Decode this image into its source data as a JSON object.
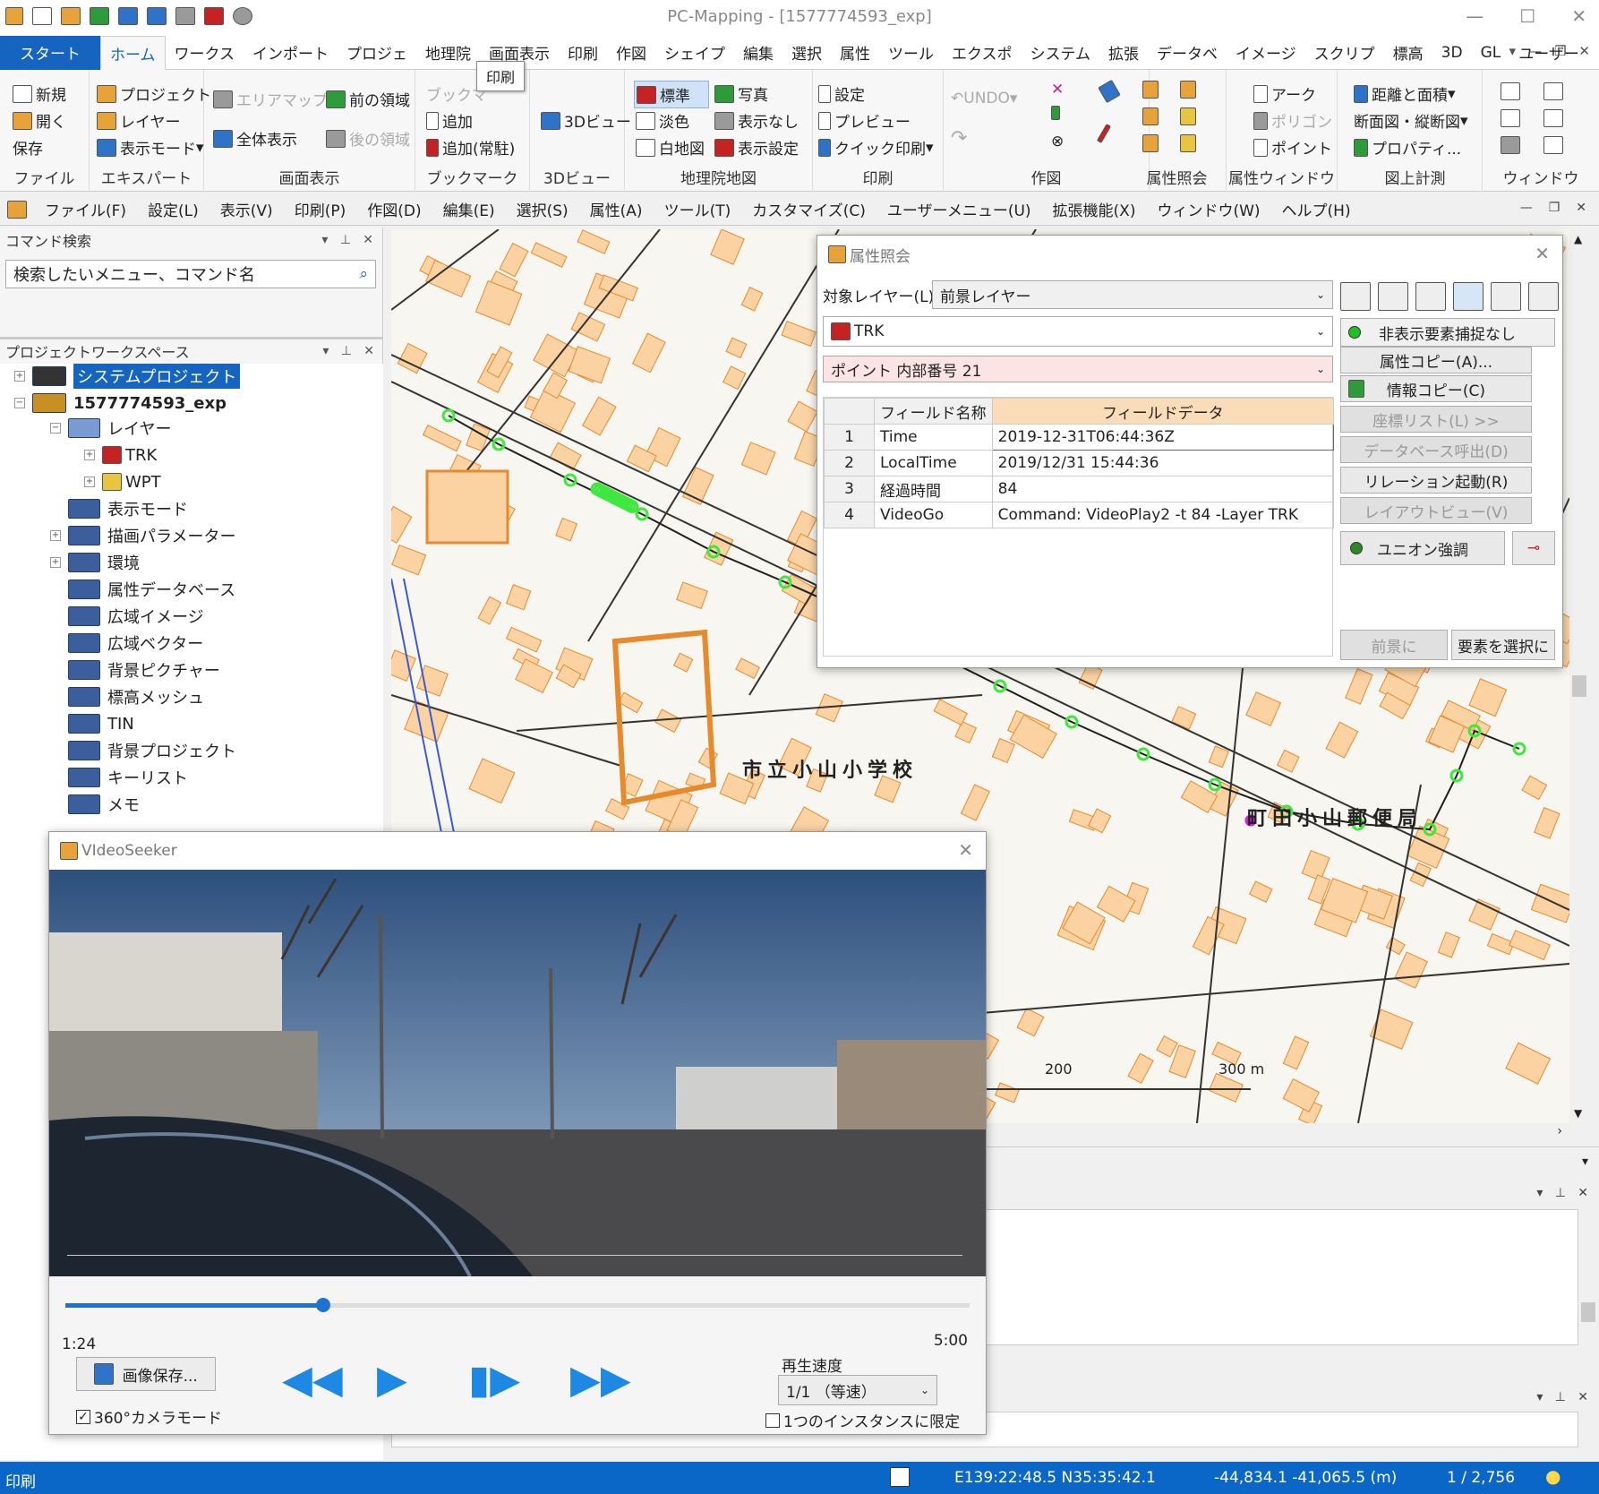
{
  "app": {
    "title": "PC-Mapping - [1577774593_exp]"
  },
  "tabs": [
    "スタート",
    "ホーム",
    "ワークス",
    "インポート",
    "プロジェ",
    "地理院",
    "画面表示",
    "印刷",
    "作図",
    "シェイプ",
    "編集",
    "選択",
    "属性",
    "ツール",
    "エクスポ",
    "システム",
    "拡張",
    "データベ",
    "イメージ",
    "スクリプ",
    "標高",
    "3D",
    "GL",
    "ユーザー"
  ],
  "tooltip": "印刷",
  "ribbon": {
    "file": {
      "label": "ファイル",
      "new": "新規",
      "open": "開く",
      "save": "保存"
    },
    "expert": {
      "label": "エキスパート",
      "project": "プロジェクト",
      "layer": "レイヤー",
      "display_mode": "表示モード"
    },
    "screen": {
      "label": "画面表示",
      "area_map": "エリアマップ",
      "full": "全体表示",
      "prev": "前の領域",
      "next": "後の領域"
    },
    "bookmark": {
      "label": "ブックマーク",
      "bm": "ブックマ",
      "add": "追加",
      "add_resident": "追加(常駐)"
    },
    "view3d": {
      "label": "3Dビュー",
      "btn": "3Dビュー"
    },
    "gsi": {
      "label": "地理院地図",
      "standard": "標準",
      "pale": "淡色",
      "blank": "白地図",
      "photo": "写真",
      "hide": "表示なし",
      "settings": "表示設定"
    },
    "print": {
      "label": "印刷",
      "settings": "設定",
      "preview": "プレビュー",
      "quick": "クイック印刷"
    },
    "draw": {
      "label": "作図",
      "undo": "UNDO"
    },
    "attr": {
      "label": "属性照会"
    },
    "attrwin": {
      "label": "属性ウィンドウ",
      "arc": "アーク",
      "polygon": "ポリゴン",
      "point": "ポイント"
    },
    "measure": {
      "label": "図上計測",
      "dist": "距離と面積",
      "section": "断面図・縦断図",
      "props": "プロパティ..."
    },
    "window": {
      "label": "ウィンドウ"
    }
  },
  "menubar": [
    "ファイル(F)",
    "設定(L)",
    "表示(V)",
    "印刷(P)",
    "作図(D)",
    "編集(E)",
    "選択(S)",
    "属性(A)",
    "ツール(T)",
    "カスタマイズ(C)",
    "ユーザーメニュー(U)",
    "拡張機能(X)",
    "ウィンドウ(W)",
    "ヘルプ(H)"
  ],
  "cmd": {
    "title": "コマンド検索",
    "placeholder": "検索したいメニュー、コマンド名"
  },
  "workspace": {
    "title": "プロジェクトワークスペース",
    "system": "システムプロジェクト",
    "project": "1577774593_exp",
    "layer": "レイヤー",
    "trk": "TRK",
    "wpt": "WPT",
    "items": [
      "表示モード",
      "描画パラメーター",
      "環境",
      "属性データベース",
      "広域イメージ",
      "広域ベクター",
      "背景ピクチャー",
      "標高メッシュ",
      "TIN",
      "背景プロジェクト",
      "キーリスト",
      "メモ"
    ]
  },
  "map": {
    "school": "市立小山小学校",
    "post": "町田小山郵便局",
    "scale200": "200",
    "scale300": "300 m"
  },
  "attr_dialog": {
    "title": "属性照会",
    "target_label": "対象レイヤー(L)",
    "target": "前景レイヤー",
    "layer": "TRK",
    "hidden": "非表示要素捕捉なし",
    "element": "ポイント 内部番号 21",
    "col_name": "フィールド名称",
    "col_data": "フィールドデータ",
    "rows": [
      {
        "n": "1",
        "name": "Time",
        "data": "2019-12-31T06:44:36Z"
      },
      {
        "n": "2",
        "name": "LocalTime",
        "data": "2019/12/31 15:44:36"
      },
      {
        "n": "3",
        "name": "経過時間",
        "data": "84"
      },
      {
        "n": "4",
        "name": "VideoGo",
        "data": "Command: VideoPlay2 -t 84 -Layer TRK"
      }
    ],
    "btn_copy_attr": "属性コピー(A)...",
    "btn_copy_info": "情報コピー(C)",
    "btn_coord": "座標リスト(L) >>",
    "btn_db": "データベース呼出(D)",
    "btn_relation": "リレーション起動(R)",
    "btn_layout": "レイアウトビュー(V)",
    "btn_union": "ユニオン強調",
    "btn_front": "前景に",
    "btn_select": "要素を選択に"
  },
  "video": {
    "title": "VIdeoSeeker",
    "time": "1:24",
    "total": "5:00",
    "progress": 0.285,
    "save": "画像保存...",
    "speed_label": "再生速度",
    "speed": "1/1 （等速）",
    "cam360": "360°カメラモード",
    "single": "1つのインスタンスに限定"
  },
  "status": {
    "left": "印刷",
    "coord": "E139:22:48.5 N35:35:42.1",
    "xy": "-44,834.1 -41,065.5 (m)",
    "page": "1 / 2,756"
  },
  "colors": {
    "accent": "#1565c0",
    "status": "#0a67c8",
    "block": "#fbd3a3",
    "block_border": "#e68a2e",
    "track": "#1e1e1e",
    "point": "#3ee83e"
  }
}
